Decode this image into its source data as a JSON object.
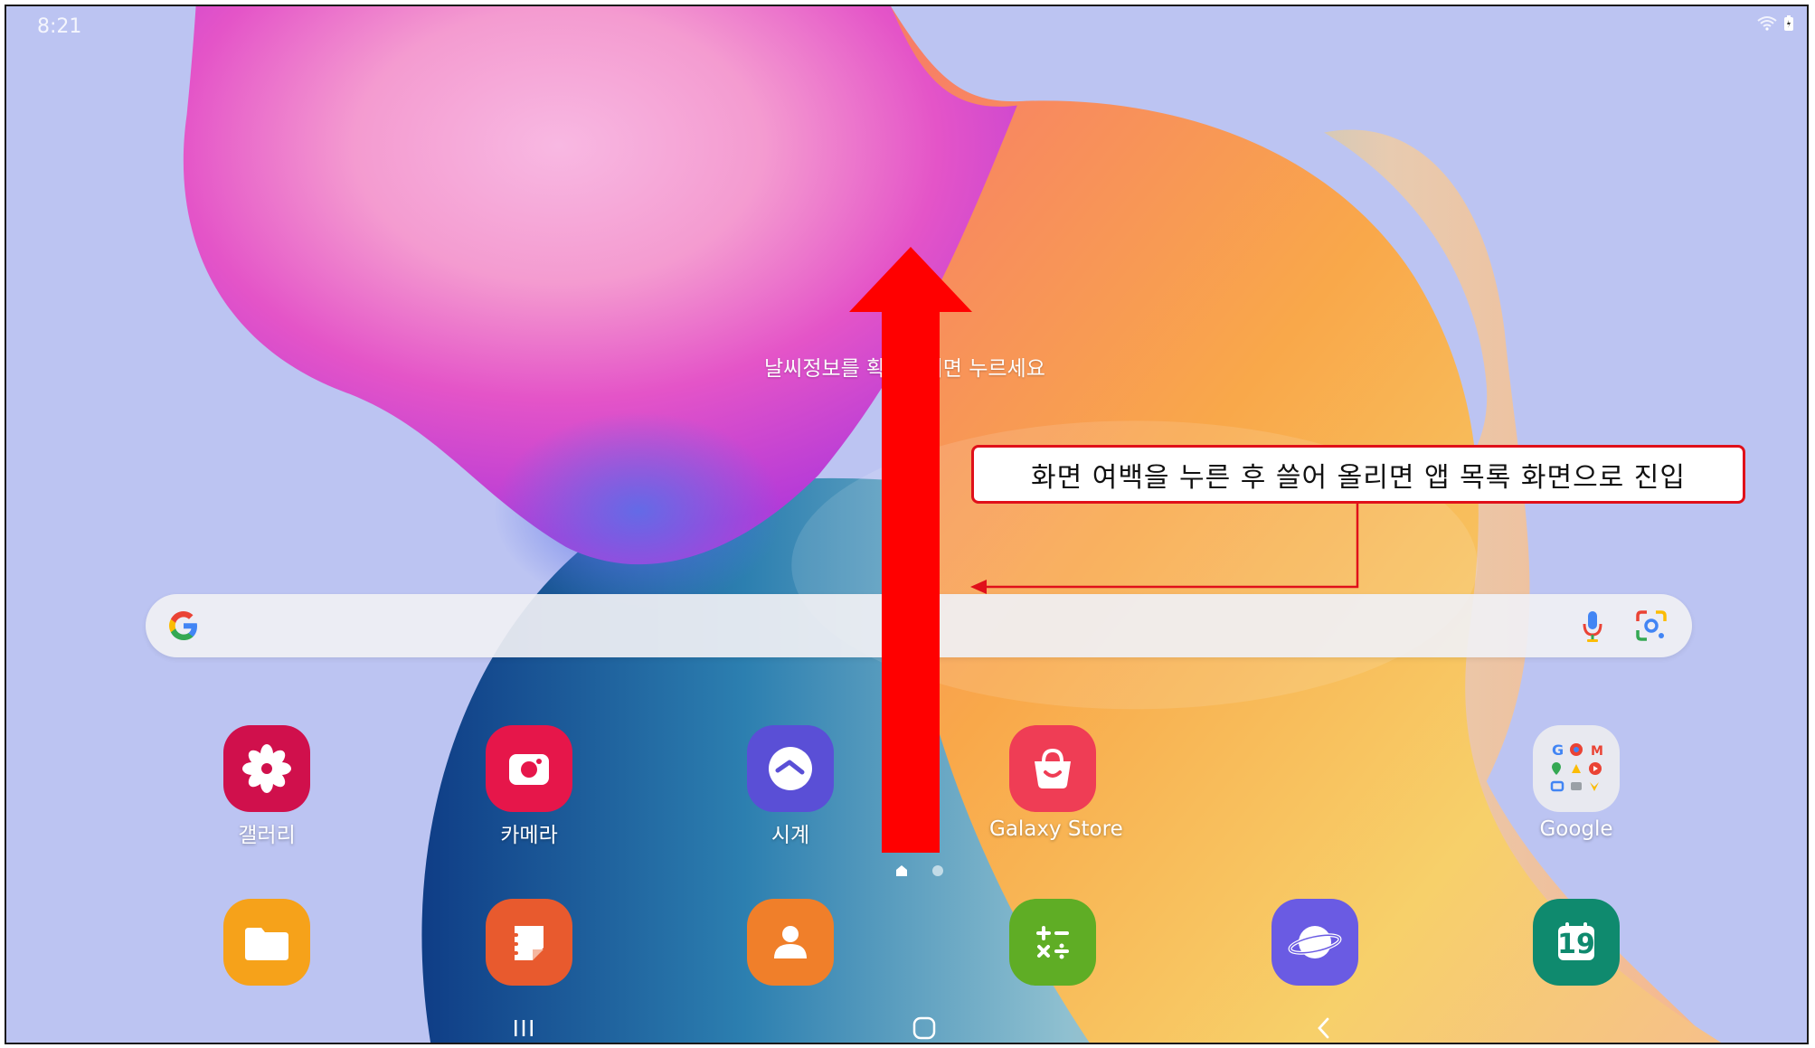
{
  "status_bar": {
    "time": "8:21",
    "wifi_icon": "wifi-icon",
    "battery_icon": "battery-icon"
  },
  "weather_widget": {
    "text": "날씨정보를 확인하려면 누르세요"
  },
  "search_bar": {
    "logo": "google-g-icon",
    "mic": "mic-icon",
    "lens": "google-lens-icon"
  },
  "apps_row1": [
    {
      "label": "갤러리",
      "icon": "gallery-flower-icon",
      "color": "#d0104c"
    },
    {
      "label": "카메라",
      "icon": "camera-icon",
      "color": "#e6164a"
    },
    {
      "label": "시계",
      "icon": "clock-icon",
      "color": "#5a4fd6"
    },
    {
      "label": "Galaxy Store",
      "icon": "shopping-bag-icon",
      "color": "#ef3d55"
    },
    {
      "label": "Google",
      "icon": "google-folder-icon",
      "color": "#f1f1f1"
    }
  ],
  "apps_row2": [
    {
      "icon": "folder-files-icon",
      "color": "#f6a21a"
    },
    {
      "icon": "notes-icon",
      "color": "#e85a2e"
    },
    {
      "icon": "contacts-person-icon",
      "color": "#f07f2a"
    },
    {
      "icon": "calculator-icon",
      "color": "#5fad25"
    },
    {
      "icon": "internet-planet-icon",
      "color": "#6a5be3"
    },
    {
      "icon": "calendar-icon",
      "label_number": "19",
      "color": "#0f8a6e"
    }
  ],
  "page_indicator": {
    "pages": 2,
    "current": 1
  },
  "nav_bar": {
    "recents": "recents-icon",
    "home": "home-icon",
    "back": "back-icon"
  },
  "annotation": {
    "text": "화면 여백을 누른 후 쓸어 올리면 앱 목록 화면으로 진입",
    "accent_color": "#e0101a"
  }
}
